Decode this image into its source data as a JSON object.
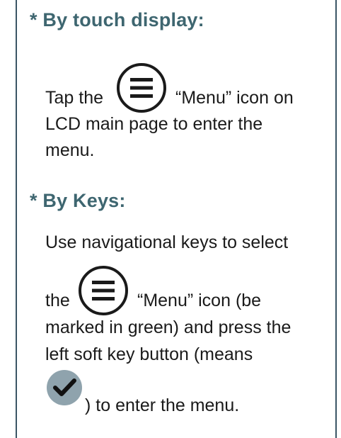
{
  "section_touch": {
    "heading": "* By touch display:",
    "line1_before": "Tap the",
    "line1_after": "“Menu” icon on",
    "line2": "LCD main page to enter the",
    "line3": "menu."
  },
  "section_keys": {
    "heading": "* By Keys:",
    "line1": "Use navigational keys to select",
    "line2_before": "the",
    "line2_after": "“Menu” icon (be",
    "line3": "marked in green) and press the",
    "line4": "left soft key button (means",
    "line5_after": ") to enter the menu."
  },
  "icons": {
    "menu": "menu-icon",
    "check": "check-icon",
    "menu_stroke_color": "#1a1a1a",
    "check_fill_color": "#8fa3ad"
  }
}
